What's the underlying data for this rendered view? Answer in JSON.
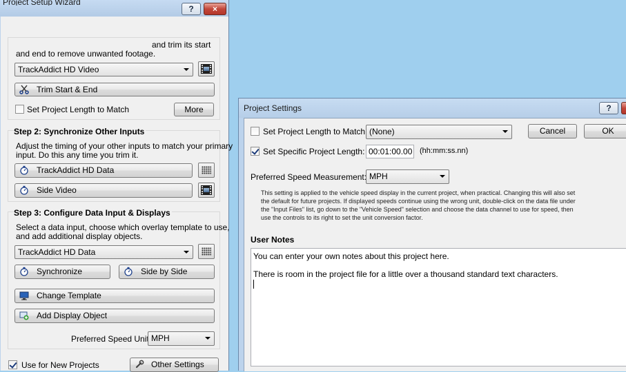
{
  "wizard": {
    "title": "Project Setup Wizard",
    "help_label": "?",
    "close_label": "×",
    "intro_partial": "and trim its start",
    "intro_line2": "and end to remove unwanted footage.",
    "video_source": "TrackAddict HD Video",
    "trim_label": "Trim Start & End",
    "set_length_label": "Set Project Length to Match",
    "more_label": "More",
    "step2_title": "Step 2: Synchronize Other Inputs",
    "step2_desc1": "Adjust the timing of your other inputs to match your primary",
    "step2_desc2": "input. Do this any time you trim it.",
    "input1_label": "TrackAddict HD Data",
    "input2_label": "Side Video",
    "step3_title": "Step 3: Configure Data Input & Displays",
    "step3_desc1": "Select a data input, choose which overlay template to use,",
    "step3_desc2": "and add additional display objects.",
    "data_input": "TrackAddict HD Data",
    "synchronize_label": "Synchronize",
    "side_by_side_label": "Side by Side",
    "change_template_label": "Change Template",
    "add_display_label": "Add Display Object",
    "speed_unit_label": "Preferred Speed Unit:",
    "speed_unit_value": "MPH",
    "use_new_label": "Use for New Projects",
    "use_new_checked": true,
    "other_settings_label": "Other Settings"
  },
  "settings": {
    "title": "Project Settings",
    "help_label": "?",
    "match_label": "Set Project Length to Match:",
    "match_checked": false,
    "match_value": "(None)",
    "cancel_label": "Cancel",
    "ok_label": "OK",
    "specific_label": "Set Specific Project Length:",
    "specific_checked": true,
    "length_value": "00:01:00.00",
    "length_format": "(hh:mm:ss.nn)",
    "speed_label": "Preferred Speed Measurement:",
    "speed_value": "MPH",
    "help_line1": "This setting is applied to the vehicle speed display in the current project, when practical. Changing this will also set",
    "help_line2": "the default for future projects. If displayed speeds continue using the wrong unit, double-click on the data file under",
    "help_line3": "the \"Input Files\" list, go down to the \"Vehicle Speed\" selection and choose the data channel to use for speed, then",
    "help_line4": "use the controls to its right to set the unit conversion factor.",
    "notes_title": "User Notes",
    "notes_line1": "You can enter your own notes about this project here.",
    "notes_line2": "There is room in the project file for a little over a thousand standard text characters."
  },
  "colors": {
    "desktop": "#9fcfee",
    "window_frame": "#bcd3ec",
    "client": "#f0f0f0",
    "close_red": "#c2463a"
  }
}
